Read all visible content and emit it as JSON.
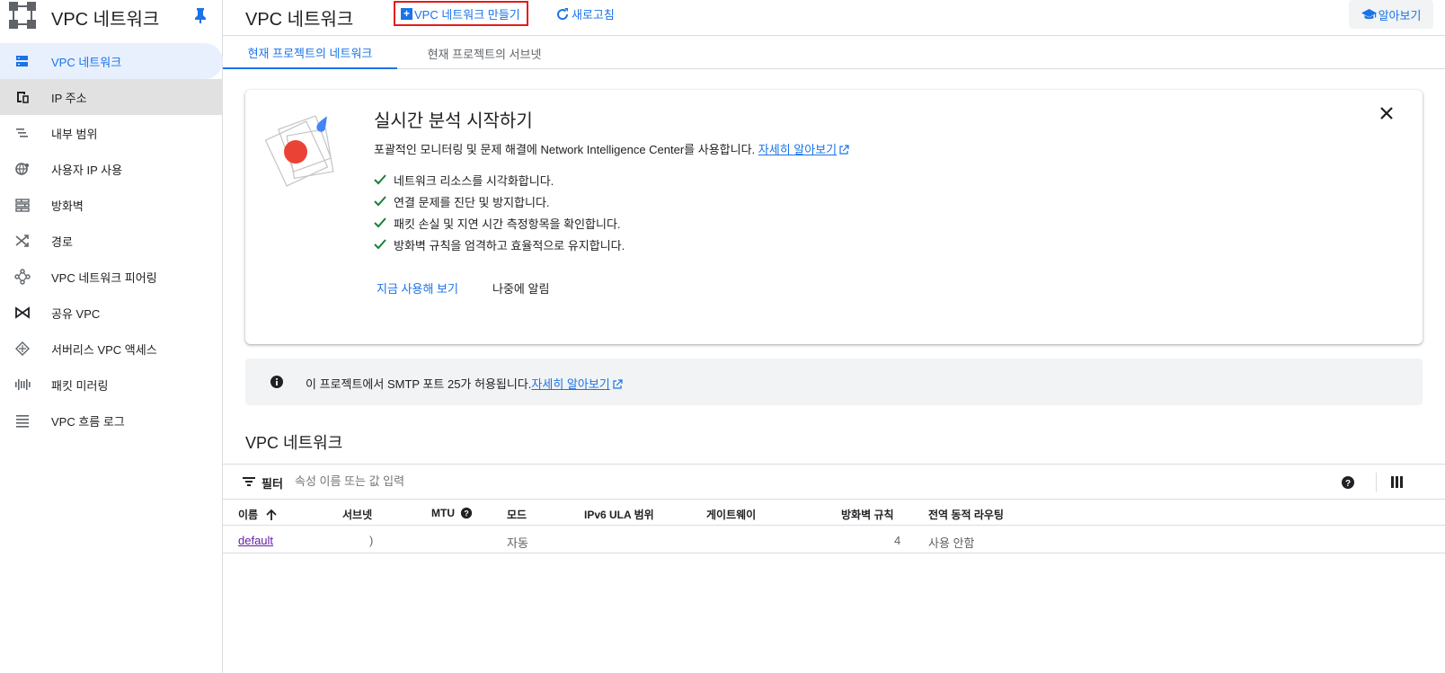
{
  "sidebar": {
    "title": "VPC 네트워크",
    "items": [
      {
        "label": "VPC 네트워크",
        "icon": "vpc-network-icon"
      },
      {
        "label": "IP 주소",
        "icon": "ip-address-icon"
      },
      {
        "label": "내부 범위",
        "icon": "internal-range-icon"
      },
      {
        "label": "사용자 IP 사용",
        "icon": "globe-icon"
      },
      {
        "label": "방화벽",
        "icon": "firewall-icon"
      },
      {
        "label": "경로",
        "icon": "routes-icon"
      },
      {
        "label": "VPC 네트워크 피어링",
        "icon": "peering-icon"
      },
      {
        "label": "공유 VPC",
        "icon": "shared-vpc-icon"
      },
      {
        "label": "서버리스 VPC 액세스",
        "icon": "serverless-icon"
      },
      {
        "label": "패킷 미러링",
        "icon": "packet-mirroring-icon"
      },
      {
        "label": "VPC 흐름 로그",
        "icon": "flow-logs-icon"
      }
    ]
  },
  "header": {
    "title": "VPC 네트워크",
    "create_label": "VPC 네트워크 만들기",
    "refresh_label": "새로고침",
    "learn_label": "알아보기"
  },
  "tabs": [
    {
      "label": "현재 프로젝트의 네트워크"
    },
    {
      "label": "현재 프로젝트의 서브넷"
    }
  ],
  "promo": {
    "title": "실시간 분석 시작하기",
    "description": "포괄적인 모니터링 및 문제 해결에 Network Intelligence Center를 사용합니다.",
    "learn_more": "자세히 알아보기",
    "checks": [
      "네트워크 리소스를 시각화합니다.",
      "연결 문제를 진단 및 방지합니다.",
      "패킷 손실 및 지연 시간 측정항목을 확인합니다.",
      "방화벽 규칙을 엄격하고 효율적으로 유지합니다."
    ],
    "try_now": "지금 사용해 보기",
    "remind_later": "나중에 알림"
  },
  "banner": {
    "text": "이 프로젝트에서 SMTP 포트 25가 허용됩니다.",
    "link": "자세히 알아보기"
  },
  "table": {
    "section_title": "VPC 네트워크",
    "filter_label": "필터",
    "filter_placeholder": "속성 이름 또는 값 입력",
    "columns": [
      "이름",
      "서브넷",
      "MTU",
      "모드",
      "IPv6 ULA 범위",
      "게이트웨이",
      "방화벽 규칙",
      "전역 동적 라우팅"
    ],
    "rows": [
      {
        "name": "default",
        "subnet": ")",
        "mtu": "",
        "mode": "자동",
        "ipv6": "",
        "gateway": "",
        "firewall": "4",
        "routing": "사용 안함"
      }
    ]
  },
  "colors": {
    "accent": "#1a73e8",
    "highlight_border": "#e31b1b",
    "check": "#188038",
    "visited_link": "#681da8"
  }
}
